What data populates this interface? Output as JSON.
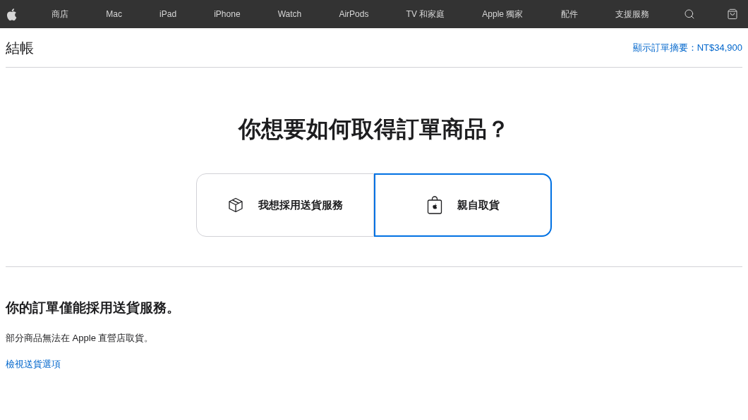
{
  "nav": {
    "items": [
      "商店",
      "Mac",
      "iPad",
      "iPhone",
      "Watch",
      "AirPods",
      "TV 和家庭",
      "Apple 獨家",
      "配件",
      "支援服務"
    ]
  },
  "header": {
    "title": "結帳",
    "summary_link": "顯示訂單摘要：NT$34,900"
  },
  "heading": "你想要如何取得訂單商品？",
  "options": [
    {
      "kind": "delivery",
      "label": "我想採用送貨服務",
      "selected": false
    },
    {
      "kind": "pickup",
      "label": "親自取貨",
      "selected": true
    }
  ],
  "notice": {
    "title": "你的訂單僅能採用送貨服務。",
    "text": "部分商品無法在 Apple 直營店取貨。",
    "link": "檢視送貨選項"
  }
}
